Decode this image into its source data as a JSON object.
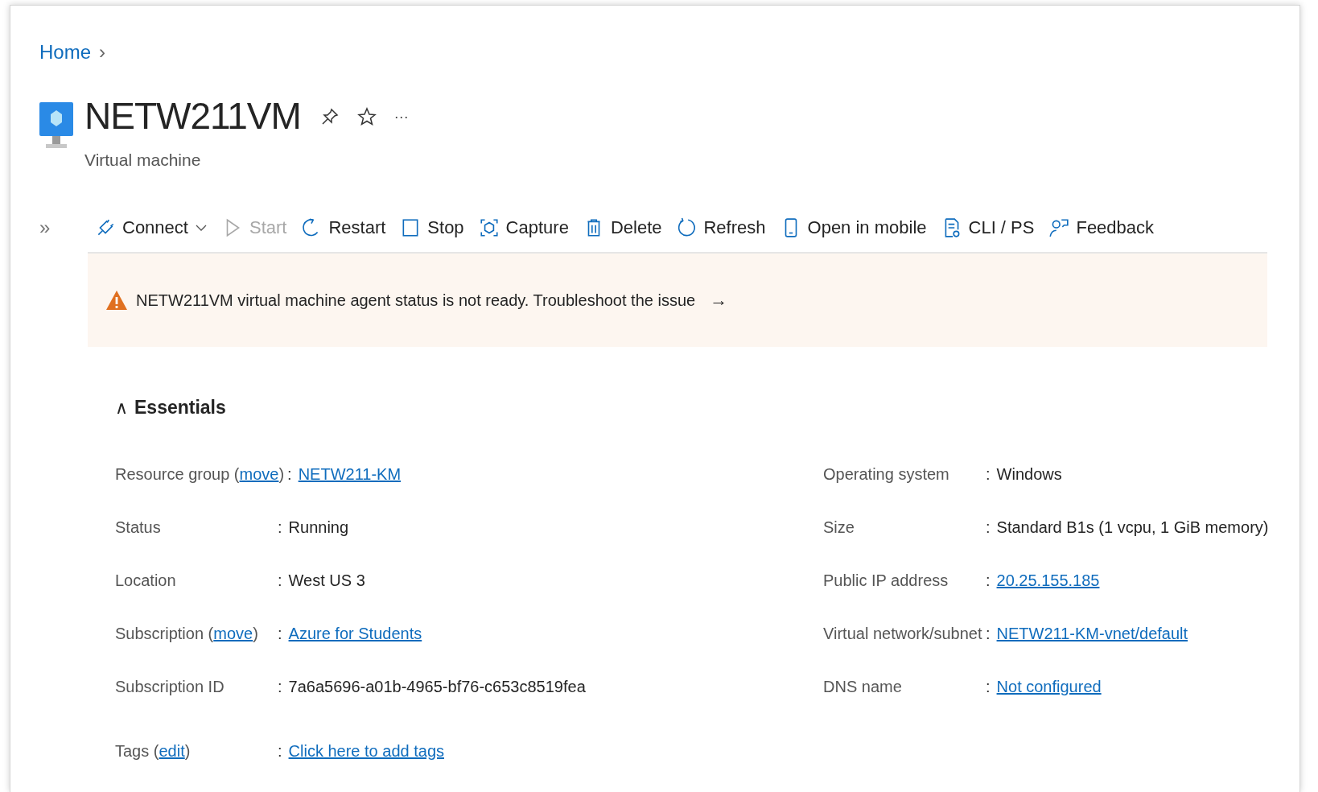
{
  "breadcrumb": {
    "items": [
      "Home"
    ],
    "chevron": "›"
  },
  "header": {
    "title": "NETW211VM",
    "subtitle": "Virtual machine",
    "more": "···"
  },
  "toolbar": {
    "collapse": "»",
    "items": [
      {
        "kind": "connect",
        "label": "Connect",
        "dropdown": true,
        "disabled": false
      },
      {
        "kind": "start",
        "label": "Start",
        "dropdown": false,
        "disabled": true
      },
      {
        "kind": "restart",
        "label": "Restart",
        "dropdown": false,
        "disabled": false
      },
      {
        "kind": "stop",
        "label": "Stop",
        "dropdown": false,
        "disabled": false
      },
      {
        "kind": "capture",
        "label": "Capture",
        "dropdown": false,
        "disabled": false
      },
      {
        "kind": "delete",
        "label": "Delete",
        "dropdown": false,
        "disabled": false
      },
      {
        "kind": "refresh",
        "label": "Refresh",
        "dropdown": false,
        "disabled": false
      },
      {
        "kind": "mobile",
        "label": "Open in mobile",
        "dropdown": false,
        "disabled": false
      },
      {
        "kind": "cli",
        "label": "CLI / PS",
        "dropdown": false,
        "disabled": false
      },
      {
        "kind": "feedback",
        "label": "Feedback",
        "dropdown": false,
        "disabled": false
      }
    ]
  },
  "banner": {
    "message": "NETW211VM virtual machine agent status is not ready. Troubleshoot the issue",
    "arrow": "→"
  },
  "essentials": {
    "title": "Essentials",
    "expanded": true,
    "caret": "∧",
    "left": [
      {
        "label": "Resource group (",
        "action": "move",
        "label_end": ")",
        "sep": ":",
        "value": "NETW211-KM",
        "link": true
      },
      {
        "label": "Status",
        "sep": ":",
        "value": "Running",
        "link": false
      },
      {
        "label": "Location",
        "sep": ":",
        "value": "West US 3",
        "link": false
      },
      {
        "label": "Subscription (",
        "action": "move",
        "label_end": ")",
        "sep": ":",
        "value": "Azure for Students",
        "link": true
      },
      {
        "label": "Subscription ID",
        "sep": ":",
        "value": "7a6a5696-a01b-4965-bf76-c653c8519fea",
        "link": false
      }
    ],
    "right": [
      {
        "label": "Operating system",
        "sep": ":",
        "value": "Windows",
        "link": false
      },
      {
        "label": "Size",
        "sep": ":",
        "value": "Standard B1s (1 vcpu, 1 GiB memory)",
        "link": false
      },
      {
        "label": "Public IP address",
        "sep": ":",
        "value": "20.25.155.185",
        "link": true
      },
      {
        "label": "Virtual network/subnet",
        "sep": ":",
        "value": "NETW211-KM-vnet/default",
        "link": true
      },
      {
        "label": "DNS name",
        "sep": ":",
        "value": "Not configured",
        "link": true
      }
    ],
    "tags": {
      "label": "Tags (",
      "action": "edit",
      "label_end": ")",
      "sep": ":",
      "value": "Click here to add tags",
      "link": true
    }
  }
}
